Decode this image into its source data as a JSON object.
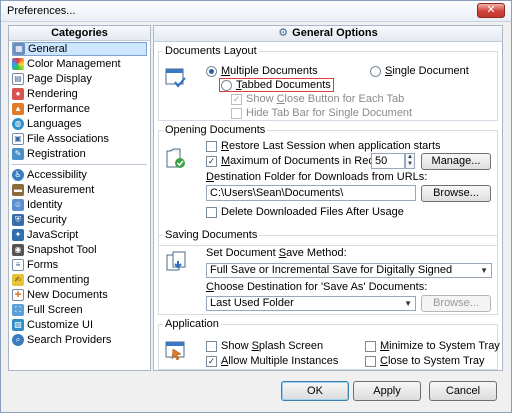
{
  "window": {
    "title": "Preferences..."
  },
  "colors": {
    "accent": "#2b5fa8",
    "selection": "#cde6ff",
    "close": "#c7433a"
  },
  "categories": {
    "header": "Categories",
    "items": [
      {
        "label": "General",
        "icon": "general-icon"
      },
      {
        "label": "Color Management",
        "icon": "color-management-icon"
      },
      {
        "label": "Page Display",
        "icon": "page-display-icon"
      },
      {
        "label": "Rendering",
        "icon": "rendering-icon"
      },
      {
        "label": "Performance",
        "icon": "performance-icon"
      },
      {
        "label": "Languages",
        "icon": "languages-icon"
      },
      {
        "label": "File Associations",
        "icon": "file-associations-icon"
      },
      {
        "label": "Registration",
        "icon": "registration-icon"
      },
      {
        "label": "Accessibility",
        "icon": "accessibility-icon"
      },
      {
        "label": "Measurement",
        "icon": "measurement-icon"
      },
      {
        "label": "Identity",
        "icon": "identity-icon"
      },
      {
        "label": "Security",
        "icon": "security-icon"
      },
      {
        "label": "JavaScript",
        "icon": "javascript-icon"
      },
      {
        "label": "Snapshot Tool",
        "icon": "snapshot-tool-icon"
      },
      {
        "label": "Forms",
        "icon": "forms-icon"
      },
      {
        "label": "Commenting",
        "icon": "commenting-icon"
      },
      {
        "label": "New Documents",
        "icon": "new-documents-icon"
      },
      {
        "label": "Full Screen",
        "icon": "full-screen-icon"
      },
      {
        "label": "Customize UI",
        "icon": "customize-ui-icon"
      },
      {
        "label": "Search Providers",
        "icon": "search-providers-icon"
      }
    ]
  },
  "general": {
    "header": "General Options",
    "documents_layout": {
      "legend": "Documents Layout",
      "multiple_pre": "",
      "multiple_key": "M",
      "multiple_post": "ultiple Documents",
      "single_pre": "",
      "single_key": "S",
      "single_post": "ingle Document",
      "tabbed_pre": "",
      "tabbed_key": "T",
      "tabbed_post": "abbed Documents",
      "show_close_pre": "Show ",
      "show_close_key": "C",
      "show_close_post": "lose Button for Each Tab",
      "hide_tab_bar": "Hide Tab Bar for Single Document"
    },
    "opening": {
      "legend": "Opening Documents",
      "restore_pre": "",
      "restore_key": "R",
      "restore_post": "estore Last Session when application starts",
      "max_pre": "",
      "max_key": "M",
      "max_post": "aximum of Documents in Recents:",
      "max_value": "50",
      "manage": "Manage...",
      "dest_label_pre": "",
      "dest_label_key": "D",
      "dest_label_post": "estination Folder for Downloads from URLs:",
      "dest_value": "C:\\Users\\Sean\\Documents\\",
      "browse": "Browse...",
      "delete_downloaded": "Delete Downloaded Files After Usage"
    },
    "saving": {
      "legend": "Saving Documents",
      "method_label_pre": "Set Document ",
      "method_label_key": "S",
      "method_label_post": "ave Method:",
      "method_value": "Full Save or Incremental Save for Digitally Signed",
      "dest_label_pre": "",
      "dest_label_key": "C",
      "dest_label_post": "hoose Destination for 'Save As' Documents:",
      "dest_value": "Last Used Folder",
      "browse": "Browse..."
    },
    "application": {
      "legend": "Application",
      "splash_pre": "Show ",
      "splash_key": "S",
      "splash_post": "plash Screen",
      "allow_multiple_pre": "",
      "allow_multiple_key": "A",
      "allow_multiple_post": "llow Multiple Instances",
      "minimize_pre": "",
      "minimize_key": "M",
      "minimize_post": "inimize to System Tray",
      "close_pre": "",
      "close_key": "C",
      "close_post": "lose to System Tray"
    }
  },
  "footer": {
    "ok": "OK",
    "apply": "Apply",
    "cancel": "Cancel"
  }
}
